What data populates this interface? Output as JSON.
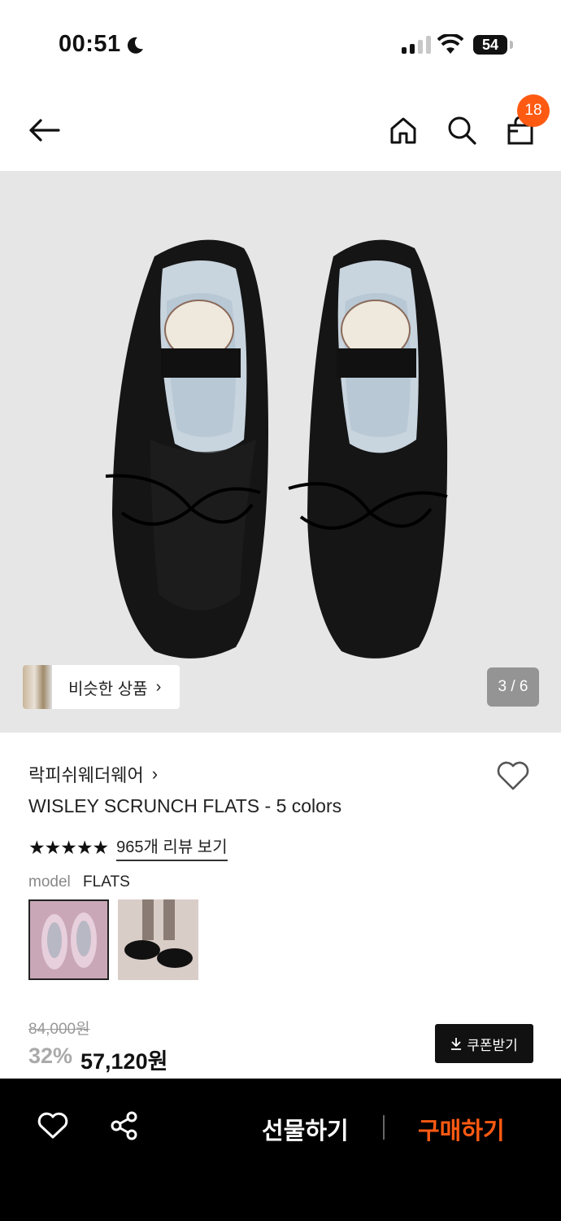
{
  "status_bar": {
    "time": "00:51",
    "battery": "54"
  },
  "nav": {
    "cart_count": "18"
  },
  "gallery": {
    "pager": "3 / 6",
    "similar_label": "비슷한 상품"
  },
  "product": {
    "brand": "락피쉬웨더웨어",
    "title": "WISLEY SCRUNCH FLATS - 5 colors",
    "stars": "★★★★★",
    "rating": 5,
    "review_link": "965개 리뷰 보기",
    "model_key": "model",
    "model_value": "FLATS",
    "swatches": [
      "pink-flats",
      "black-flats-worn"
    ]
  },
  "price": {
    "original": "84,000원",
    "discount": "32%",
    "final": "57,120원",
    "coupon_label": "쿠폰받기"
  },
  "bottom_bar": {
    "gift_label": "선물하기",
    "buy_label": "구매하기"
  },
  "colors": {
    "accent": "#ff5a12",
    "hero_bg": "#e6e6e6",
    "bottom_bg": "#000000"
  }
}
